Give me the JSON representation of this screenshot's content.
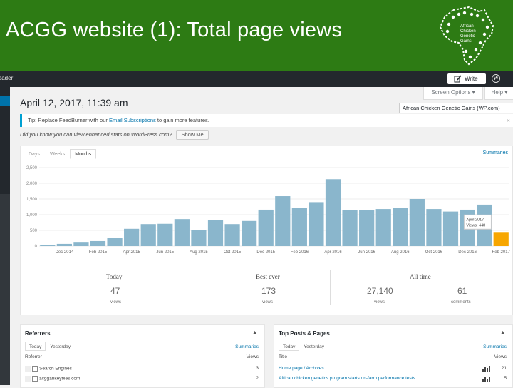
{
  "slide": {
    "title": "ACGG website (1): Total page views",
    "header_color": "#2d7b14",
    "logo_icon": "africa-map-logo-icon",
    "logo_text": [
      "African",
      "Chicken",
      "Genetic",
      "Gains"
    ]
  },
  "wp_bar": {
    "reader_label": "Reader",
    "write_label": "Write",
    "write_icon": "edit-icon",
    "wp_icon": "wordpress-logo-icon"
  },
  "page": {
    "date_title": "April 12, 2017, 11:39 am",
    "screen_options": "Screen Options ▾",
    "help": "Help ▾",
    "blog_select": "African Chicken Genetic Gains (WP.com)",
    "tip_prefix": "Tip: Replace FeedBurner with our ",
    "tip_link": "Email Subscriptions",
    "tip_suffix": " to gain more features.",
    "tip_close": "×",
    "enhanced_text": "Did you know you can view enhanced stats on WordPress.com?",
    "show_me": "Show Me"
  },
  "stats": {
    "tabs": [
      "Days",
      "Weeks",
      "Months"
    ],
    "active_tab": 2,
    "summaries": "Summaries",
    "tooltip": {
      "line1": "April 2017",
      "line2": "Views: 448"
    },
    "bar_color": "#8ab6cc",
    "highlight_color": "#f7a600"
  },
  "chart_data": {
    "type": "bar",
    "y_ticks": [
      "2,500",
      "2,000",
      "1,500",
      "1,000",
      "500",
      "0"
    ],
    "ylim": [
      0,
      2500
    ],
    "x_labels": [
      "Dec 2014",
      "Feb 2015",
      "Apr 2015",
      "Jun 2015",
      "Aug 2015",
      "Oct 2015",
      "Dec 2015",
      "Feb 2016",
      "Apr 2016",
      "Jun 2016",
      "Aug 2016",
      "Oct 2016",
      "Dec 2016",
      "Feb 2017",
      "Apr 2017"
    ],
    "values": [
      30,
      70,
      110,
      160,
      260,
      550,
      700,
      710,
      860,
      520,
      840,
      700,
      800,
      1160,
      1590,
      1210,
      1400,
      2130,
      1150,
      1140,
      1180,
      1210,
      1500,
      1180,
      1100,
      1160,
      1320,
      448
    ],
    "highlight_index": 27
  },
  "totals": {
    "today_label": "Today",
    "best_label": "Best ever",
    "alltime_label": "All time",
    "today_views": "47",
    "today_sub": "views",
    "best_views": "173",
    "best_sub": "views",
    "all_views": "27,140",
    "all_views_sub": "views",
    "all_comments": "61",
    "all_comments_sub": "comments"
  },
  "referrers": {
    "title": "Referrers",
    "toggle": "▲",
    "tabs": [
      "Today",
      "Yesterday"
    ],
    "summaries": "Summaries",
    "col_left": "Referrer",
    "col_right": "Views",
    "rows": [
      {
        "label": "Search Engines",
        "value": "3"
      },
      {
        "label": "acggankeybles.com",
        "value": "2"
      }
    ]
  },
  "top_posts": {
    "title": "Top Posts & Pages",
    "toggle": "▲",
    "tabs": [
      "Today",
      "Yesterday"
    ],
    "summaries": "Summaries",
    "col_left": "Title",
    "col_right": "Views",
    "rows": [
      {
        "label": "Home page / Archives",
        "value": "21"
      },
      {
        "label": "African chicken genetics program starts on-farm performance tests",
        "value": "5"
      }
    ]
  }
}
